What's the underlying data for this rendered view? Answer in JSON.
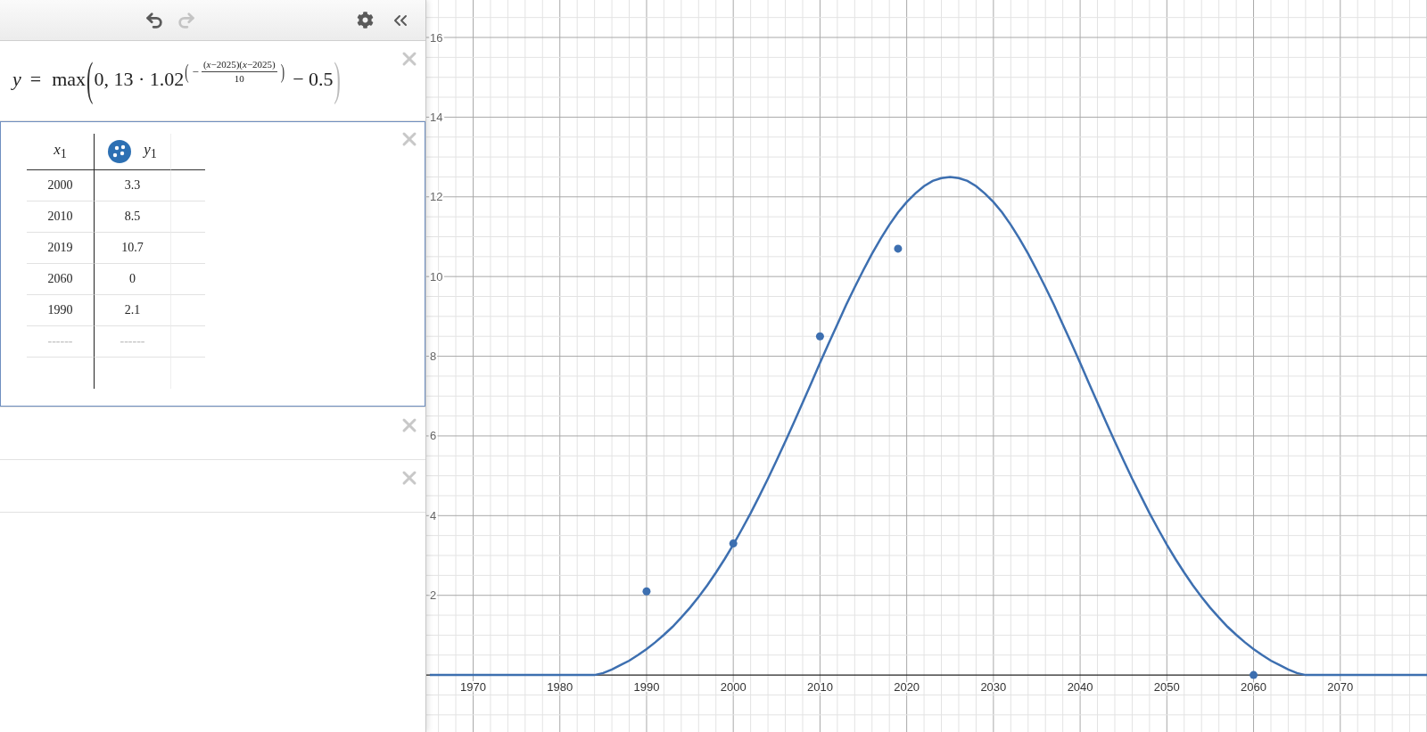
{
  "toolbar": {
    "undo": {
      "disabled": false
    },
    "redo": {
      "disabled": true
    }
  },
  "expressions": [
    {
      "kind": "formula",
      "selected": false,
      "formula": {
        "lhs": "y",
        "equals": "=",
        "func": "max",
        "open": "(",
        "body": "0, 13 · 1.02",
        "exponent": {
          "open": "(",
          "sign": "−",
          "numerator": "(*x*−2025)(*x*−2025)",
          "denominator": "10",
          "close": ")"
        },
        "tail": "− 0.5",
        "close": ")"
      }
    },
    {
      "kind": "table",
      "selected": true,
      "table": {
        "columns": [
          {
            "label": "*x*$_{1}$"
          },
          {
            "label": "*y*$_{1}$",
            "color": "#2d70b3"
          }
        ],
        "rows": [
          [
            "2000",
            "3.3"
          ],
          [
            "2010",
            "8.5"
          ],
          [
            "2019",
            "10.7"
          ],
          [
            "2060",
            "0"
          ],
          [
            "1990",
            "2.1"
          ]
        ],
        "new_row": {
          "x_placeholder": "------",
          "y_placeholder": "------"
        }
      }
    },
    {
      "kind": "empty",
      "selected": false
    },
    {
      "kind": "empty",
      "selected": false
    }
  ],
  "graph": {
    "chart_data": {
      "type": "line",
      "grid": true,
      "xlim": [
        1964.6,
        2080
      ],
      "ylim": [
        -1.43,
        16.94
      ],
      "xticks": [
        1970,
        1980,
        1990,
        2000,
        2010,
        2020,
        2030,
        2040,
        2050,
        2060,
        2070
      ],
      "yticks": [
        2,
        4,
        6,
        8,
        10,
        12,
        14,
        16
      ],
      "x": [
        1965,
        1970,
        1975,
        1980,
        1984,
        1985,
        1986,
        1987,
        1988,
        1989,
        1990,
        1991,
        1992,
        1993,
        1994,
        1995,
        1996,
        1997,
        1998,
        1999,
        2000,
        2001,
        2002,
        2003,
        2004,
        2005,
        2006,
        2007,
        2008,
        2009,
        2010,
        2011,
        2012,
        2013,
        2014,
        2015,
        2016,
        2017,
        2018,
        2019,
        2020,
        2021,
        2022,
        2023,
        2024,
        2025,
        2026,
        2027,
        2028,
        2029,
        2030,
        2031,
        2032,
        2033,
        2034,
        2035,
        2036,
        2037,
        2038,
        2039,
        2040,
        2041,
        2042,
        2043,
        2044,
        2045,
        2046,
        2047,
        2048,
        2049,
        2050,
        2051,
        2052,
        2053,
        2054,
        2055,
        2056,
        2057,
        2058,
        2059,
        2060,
        2061,
        2062,
        2063,
        2064,
        2065,
        2066,
        2070,
        2075,
        2080
      ],
      "series": [
        {
          "type": "line",
          "color": "#3d6fb0",
          "values": [
            0,
            0,
            0,
            0,
            0,
            0.05,
            0.14,
            0.25,
            0.36,
            0.5,
            0.65,
            0.82,
            1.01,
            1.21,
            1.44,
            1.69,
            1.96,
            2.25,
            2.57,
            2.91,
            3.27,
            3.66,
            4.06,
            4.49,
            4.93,
            5.39,
            5.86,
            6.34,
            6.84,
            7.33,
            7.83,
            8.32,
            8.8,
            9.28,
            9.73,
            10.16,
            10.57,
            10.95,
            11.3,
            11.61,
            11.87,
            12.09,
            12.27,
            12.4,
            12.47,
            12.5,
            12.47,
            12.4,
            12.27,
            12.09,
            11.87,
            11.61,
            11.3,
            10.95,
            10.57,
            10.16,
            9.73,
            9.28,
            8.8,
            8.32,
            7.83,
            7.33,
            6.84,
            6.34,
            5.86,
            5.39,
            4.93,
            4.49,
            4.06,
            3.66,
            3.27,
            2.91,
            2.57,
            2.25,
            1.96,
            1.69,
            1.44,
            1.21,
            1.01,
            0.82,
            0.65,
            0.5,
            0.36,
            0.25,
            0.14,
            0.05,
            0,
            0,
            0,
            0
          ]
        },
        {
          "type": "scatter",
          "color": "#3d6fb0",
          "values": [
            null,
            null,
            null,
            null,
            null,
            null,
            null,
            null,
            null,
            null,
            2.1,
            null,
            null,
            null,
            null,
            null,
            null,
            null,
            null,
            null,
            3.3,
            null,
            null,
            null,
            null,
            null,
            null,
            null,
            null,
            null,
            8.5,
            null,
            null,
            null,
            null,
            null,
            null,
            null,
            null,
            10.7,
            null,
            null,
            null,
            null,
            null,
            null,
            null,
            null,
            null,
            null,
            null,
            null,
            null,
            null,
            null,
            null,
            null,
            null,
            null,
            null,
            null,
            null,
            null,
            null,
            null,
            null,
            null,
            null,
            null,
            null,
            null,
            null,
            null,
            null,
            null,
            null,
            null,
            null,
            null,
            null,
            0,
            null,
            null,
            null,
            null,
            null,
            null,
            null,
            null,
            null
          ]
        }
      ]
    }
  }
}
